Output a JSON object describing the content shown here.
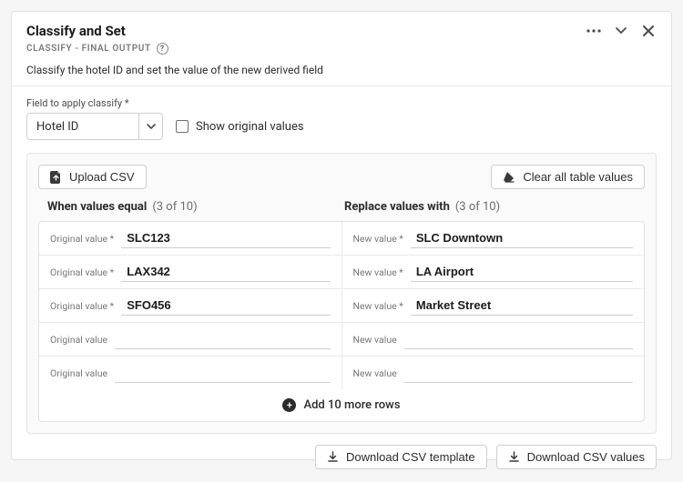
{
  "header": {
    "title": "Classify and Set",
    "subtitle": "CLASSIFY - FINAL OUTPUT",
    "description": "Classify the hotel ID and set the value of the new derived field"
  },
  "field": {
    "label": "Field to apply classify",
    "asterisk": "*",
    "selected": "Hotel ID",
    "show_original_label": "Show original values"
  },
  "buttons": {
    "upload_csv": "Upload CSV",
    "clear_all": "Clear all table values",
    "add_rows": "Add 10 more rows",
    "download_template": "Download CSV template",
    "download_values": "Download CSV values"
  },
  "columns": {
    "left_title": "When values equal",
    "right_title": "Replace values with",
    "count_text": "(3 of 10)"
  },
  "cell_labels": {
    "original": "Original value",
    "new": "New value",
    "ast": "*"
  },
  "rows": [
    {
      "original": "SLC123",
      "replacement": "SLC Downtown",
      "filled": true
    },
    {
      "original": "LAX342",
      "replacement": "LA Airport",
      "filled": true
    },
    {
      "original": "SFO456",
      "replacement": "Market Street",
      "filled": true
    },
    {
      "original": "",
      "replacement": "",
      "filled": false
    },
    {
      "original": "",
      "replacement": "",
      "filled": false
    }
  ]
}
